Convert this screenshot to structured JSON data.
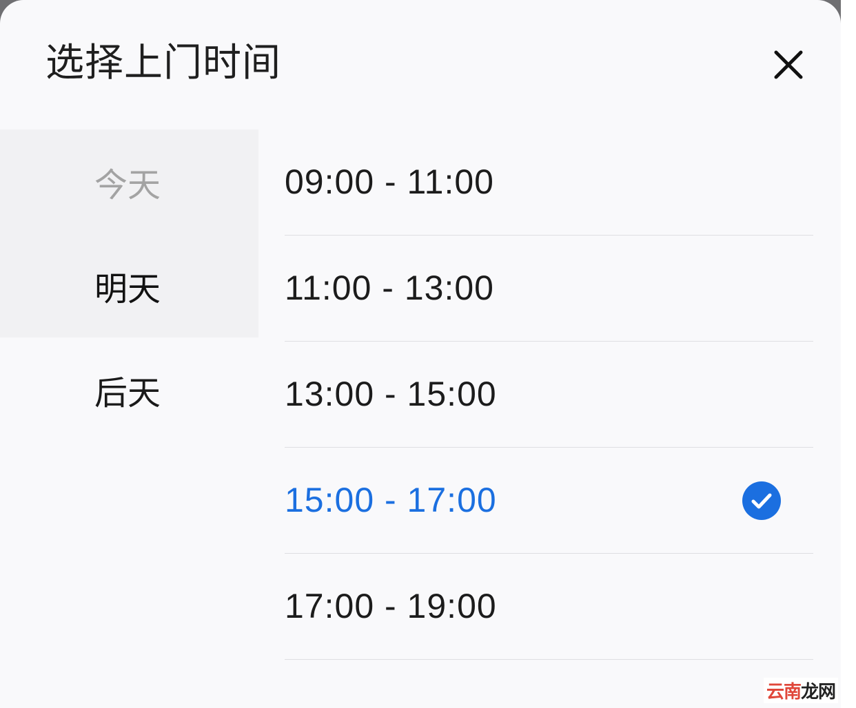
{
  "dialog": {
    "title": "选择上门时间",
    "close_icon": "close-icon"
  },
  "days": [
    {
      "label": "今天",
      "state": "disabled"
    },
    {
      "label": "明天",
      "state": "active"
    },
    {
      "label": "后天",
      "state": "normal"
    }
  ],
  "slots": [
    {
      "label": "09:00 - 11:00",
      "selected": false
    },
    {
      "label": "11:00 - 13:00",
      "selected": false
    },
    {
      "label": "13:00 - 15:00",
      "selected": false
    },
    {
      "label": "15:00 - 17:00",
      "selected": true
    },
    {
      "label": "17:00 - 19:00",
      "selected": false
    }
  ],
  "colors": {
    "accent": "#1b6fe0",
    "disabled_text": "#a3a3a3",
    "sidebar_bg": "#f1f1f3"
  },
  "selected_icon": "check-circle-icon",
  "watermark": {
    "main": "云南",
    "tail": "龙网"
  }
}
